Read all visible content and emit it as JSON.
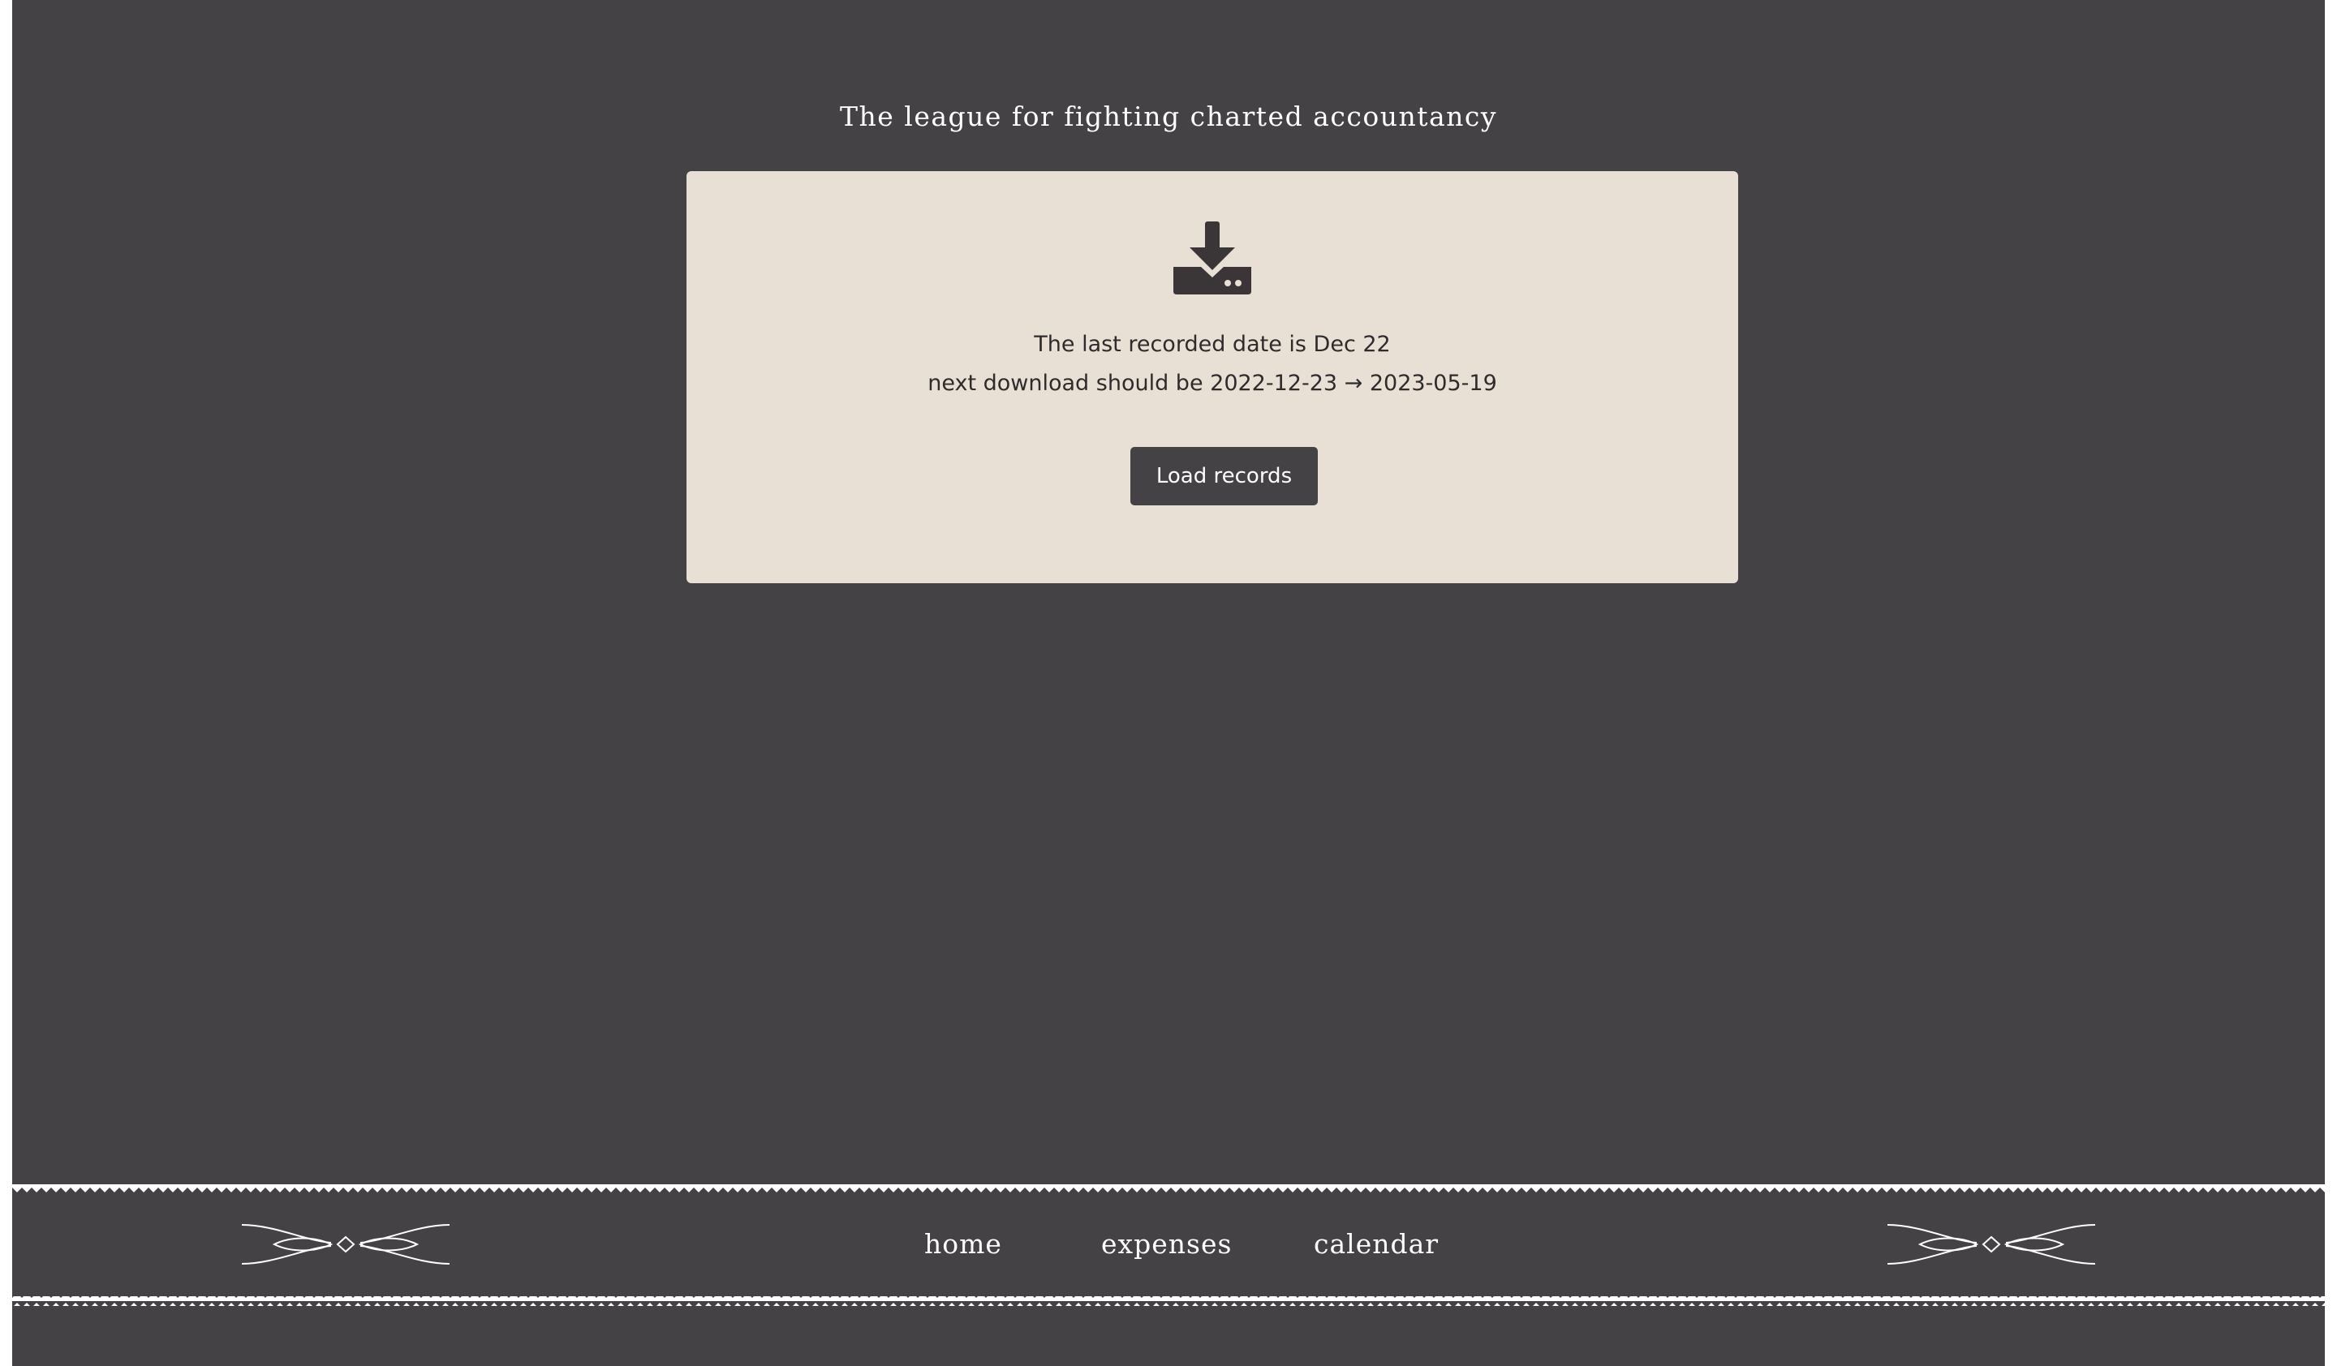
{
  "site": {
    "title": "The league for fighting charted accountancy"
  },
  "card": {
    "icon": "download-drive-icon",
    "last_recorded": "The last recorded date is Dec 22",
    "next_download": "next download should be 2022-12-23 → 2023-05-19",
    "button_label": "Load records"
  },
  "nav": {
    "links": [
      {
        "label": "home"
      },
      {
        "label": "expenses"
      },
      {
        "label": "calendar"
      }
    ],
    "left_ornament": "flourish-ornament",
    "right_ornament": "flourish-ornament"
  },
  "colors": {
    "page_background": "#444245",
    "card_background": "#e8e0d5",
    "text_dark": "#2e2b2d",
    "text_light": "#ffffff",
    "button_background": "#444245"
  }
}
